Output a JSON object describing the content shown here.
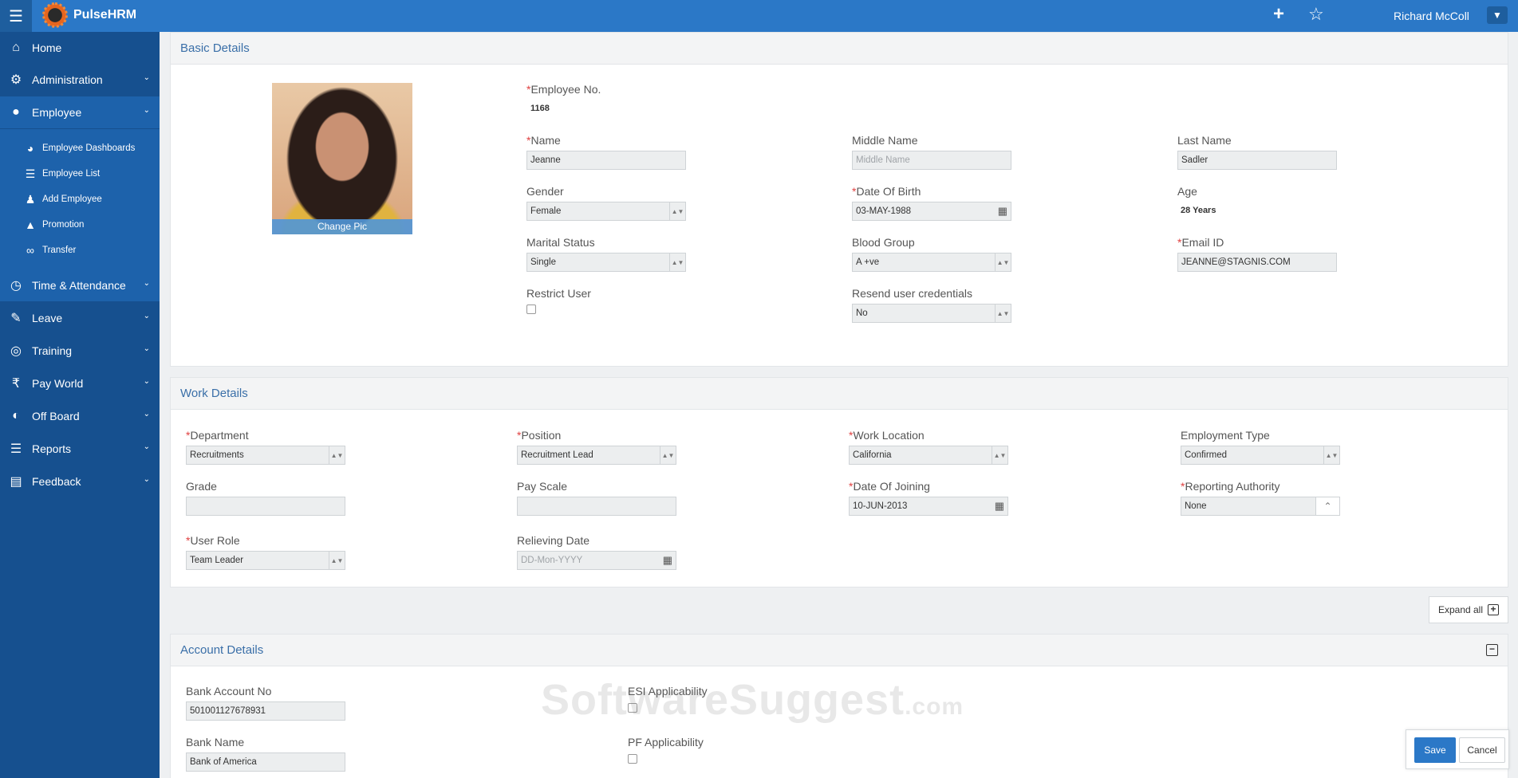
{
  "app": {
    "title": "PulseHRM",
    "user_name": "Richard McColl",
    "logo_icon": "pulse-logo-icon"
  },
  "sidebar": {
    "items": [
      {
        "label": "Home",
        "icon": "home-icon"
      },
      {
        "label": "Administration",
        "icon": "gears-icon"
      },
      {
        "label": "Employee",
        "icon": "user-icon"
      },
      {
        "label": "Time & Attendance",
        "icon": "clock-icon"
      },
      {
        "label": "Leave",
        "icon": "edit-icon"
      },
      {
        "label": "Training",
        "icon": "lifebuoy-icon"
      },
      {
        "label": "Pay World",
        "icon": "rupee-icon"
      },
      {
        "label": "Off Board",
        "icon": "toggle-icon"
      },
      {
        "label": "Reports",
        "icon": "list-icon"
      },
      {
        "label": "Feedback",
        "icon": "file-icon"
      }
    ],
    "employee_submenu": [
      {
        "label": "Employee Dashboards",
        "icon": "dashboard-icon"
      },
      {
        "label": "Employee List",
        "icon": "list-icon"
      },
      {
        "label": "Add Employee",
        "icon": "add-user-icon"
      },
      {
        "label": "Promotion",
        "icon": "graduation-cap-icon"
      },
      {
        "label": "Transfer",
        "icon": "bicycle-icon"
      }
    ]
  },
  "basic_details": {
    "title": "Basic Details",
    "change_pic": "Change Pic",
    "employee_no": {
      "label": "Employee No.",
      "value": "1168"
    },
    "name": {
      "label": "Name",
      "value": "Jeanne"
    },
    "middle_name": {
      "label": "Middle Name",
      "placeholder": "Middle Name"
    },
    "last_name": {
      "label": "Last Name",
      "value": "Sadler"
    },
    "gender": {
      "label": "Gender",
      "value": "Female"
    },
    "dob": {
      "label": "Date Of Birth",
      "value": "03-MAY-1988"
    },
    "age": {
      "label": "Age",
      "value": "28 Years"
    },
    "marital_status": {
      "label": "Marital Status",
      "value": "Single"
    },
    "blood_group": {
      "label": "Blood Group",
      "value": "A +ve"
    },
    "email": {
      "label": "Email ID",
      "value": "JEANNE@STAGNIS.COM"
    },
    "restrict_user": {
      "label": "Restrict User"
    },
    "resend": {
      "label": "Resend user credentials",
      "value": "No"
    }
  },
  "work_details": {
    "title": "Work Details",
    "department": {
      "label": "Department",
      "value": "Recruitments"
    },
    "position": {
      "label": "Position",
      "value": "Recruitment Lead"
    },
    "work_location": {
      "label": "Work Location",
      "value": "California"
    },
    "employment_type": {
      "label": "Employment Type",
      "value": "Confirmed"
    },
    "grade": {
      "label": "Grade",
      "value": ""
    },
    "pay_scale": {
      "label": "Pay Scale",
      "value": ""
    },
    "doj": {
      "label": "Date Of Joining",
      "value": "10-JUN-2013"
    },
    "reporting_authority": {
      "label": "Reporting Authority",
      "value": "None"
    },
    "user_role": {
      "label": "User Role",
      "value": "Team Leader"
    },
    "relieving_date": {
      "label": "Relieving Date",
      "placeholder": "DD-Mon-YYYY"
    }
  },
  "expand_all": "Expand all",
  "account_details": {
    "title": "Account Details",
    "bank_account_no": {
      "label": "Bank Account No",
      "value": "501001127678931"
    },
    "esi": {
      "label": "ESI Applicability"
    },
    "bank_name": {
      "label": "Bank Name",
      "value": "Bank of America"
    },
    "pf": {
      "label": "PF Applicability"
    }
  },
  "watermark": {
    "main": "SoftwareSuggest",
    "suffix": ".com"
  },
  "actions": {
    "save": "Save",
    "cancel": "Cancel"
  }
}
